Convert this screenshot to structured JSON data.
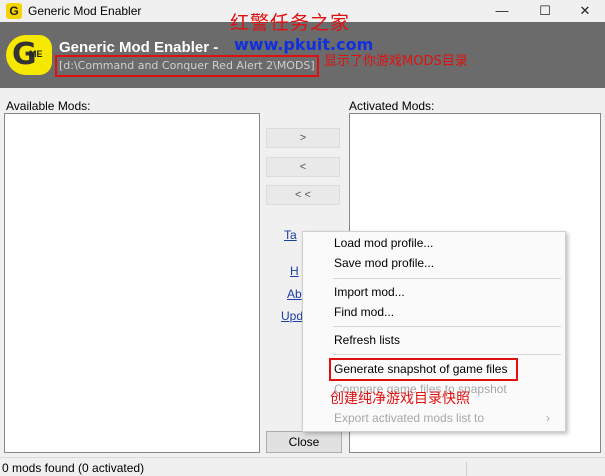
{
  "window": {
    "title": "Generic Mod Enabler",
    "controls": {
      "minimize": "—",
      "maximize": "☐",
      "close": "✕"
    }
  },
  "header": {
    "logo_letter": "G",
    "logo_sub": "ME",
    "app_name": "Generic Mod Enabler - ",
    "path": "[d:\\Command and Conquer Red Alert 2\\MODS]"
  },
  "annotations": {
    "site_title": "红警任务之家",
    "site_url": "www.pkuit.com",
    "mods_dir_note": "显示了你游戏MODS目录",
    "snapshot_note": "创建纯净游戏目录快照"
  },
  "panels": {
    "available_label": "Available Mods:",
    "activated_label": "Activated Mods:"
  },
  "buttons": {
    "add": ">",
    "remove": "<",
    "remove_all": "< <",
    "close": "Close"
  },
  "links": {
    "tools": "Ta",
    "help": "H",
    "about": "Ab",
    "update": "Upd"
  },
  "context_menu": {
    "items": [
      {
        "label": "Load mod profile...",
        "enabled": true
      },
      {
        "label": "Save mod profile...",
        "enabled": true
      },
      {
        "label": "Import mod...",
        "enabled": true
      },
      {
        "label": "Find mod...",
        "enabled": true
      },
      {
        "label": "Refresh lists",
        "enabled": true
      },
      {
        "label": "Generate snapshot of game files",
        "enabled": true
      },
      {
        "label": "Compare game files to snapshot",
        "enabled": false
      },
      {
        "label": "Export activated mods list to",
        "enabled": false,
        "submenu_arrow": "›"
      }
    ]
  },
  "status": {
    "text": "0 mods found (0 activated)"
  },
  "colors": {
    "header_bg": "#6b6b6b",
    "logo_yellow": "#f6e800",
    "annotation_red": "#e01010",
    "annotation_blue": "#1030e0"
  }
}
